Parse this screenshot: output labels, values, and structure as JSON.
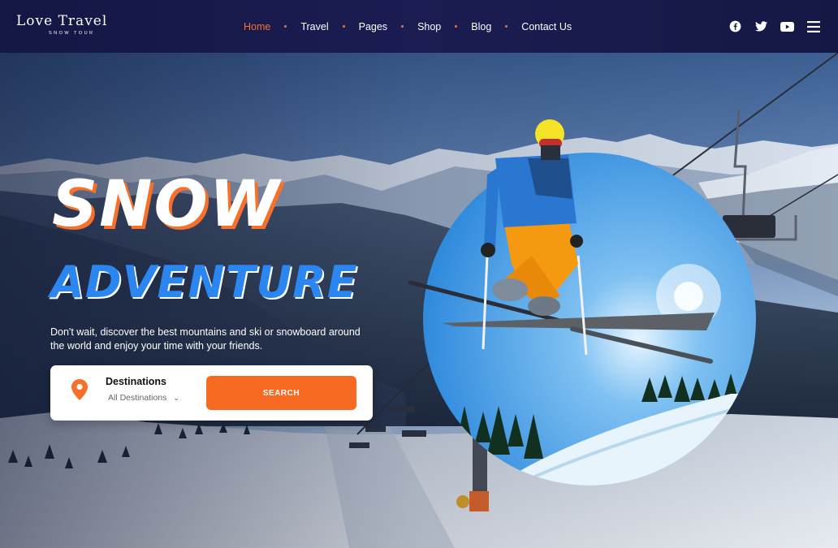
{
  "brand": {
    "name": "Love Travel",
    "tagline": "SNOW TOUR"
  },
  "nav": {
    "items": [
      {
        "label": "Home",
        "active": true
      },
      {
        "label": "Travel",
        "active": false
      },
      {
        "label": "Pages",
        "active": false
      },
      {
        "label": "Shop",
        "active": false
      },
      {
        "label": "Blog",
        "active": false
      },
      {
        "label": "Contact Us",
        "active": false
      }
    ]
  },
  "social": {
    "icons": [
      "facebook-icon",
      "twitter-icon",
      "youtube-icon",
      "menu-icon"
    ]
  },
  "hero": {
    "title_line1": "SNOW",
    "title_line2": "ADVENTURE",
    "description": "Don't wait, discover the best mountains and ski or snowboard around the world and enjoy your time with your friends."
  },
  "search": {
    "label": "Destinations",
    "selected": "All Destinations",
    "button": "SEARCH",
    "icon": "map-pin-icon"
  },
  "colors": {
    "accent": "#f7702a",
    "title_blue": "#2c86f0",
    "header_bg": "#171948"
  }
}
